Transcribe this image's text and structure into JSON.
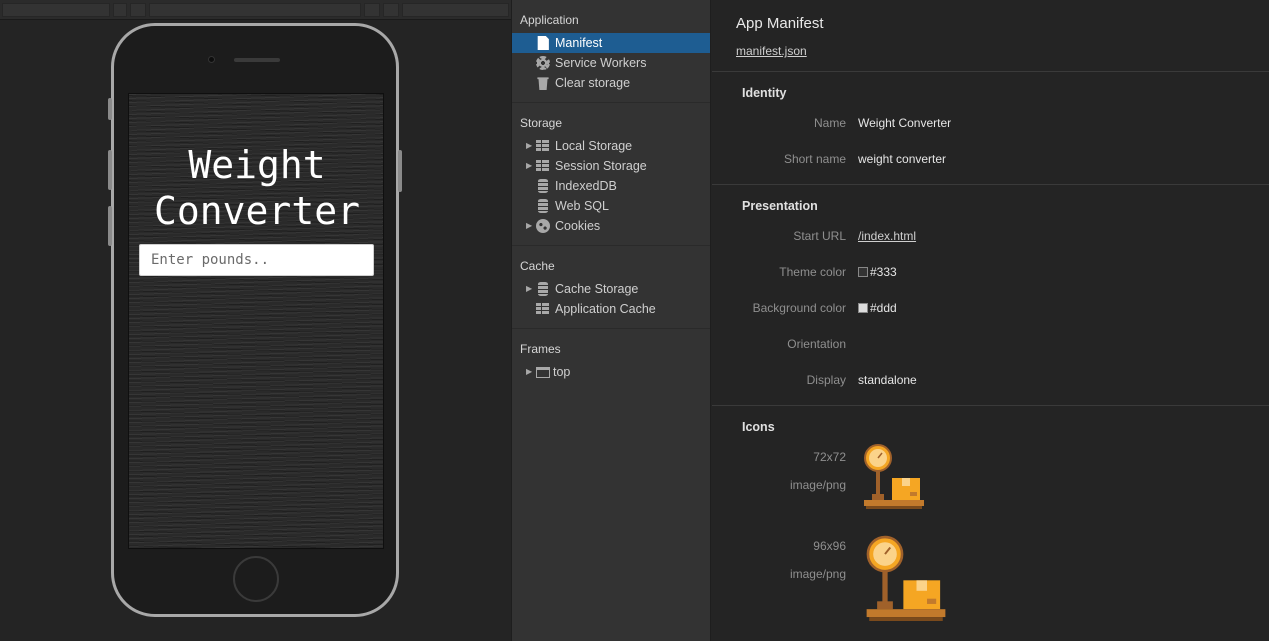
{
  "device": {
    "app_title": "Weight\nConverter",
    "input_placeholder": "Enter pounds.."
  },
  "sidebar": {
    "sections": [
      {
        "title": "Application",
        "items": [
          {
            "label": "Manifest",
            "icon": "document-icon",
            "selected": true
          },
          {
            "label": "Service Workers",
            "icon": "gear-icon"
          },
          {
            "label": "Clear storage",
            "icon": "trash-icon"
          }
        ]
      },
      {
        "title": "Storage",
        "items": [
          {
            "label": "Local Storage",
            "icon": "grid-icon",
            "expandable": true
          },
          {
            "label": "Session Storage",
            "icon": "grid-icon",
            "expandable": true
          },
          {
            "label": "IndexedDB",
            "icon": "database-icon"
          },
          {
            "label": "Web SQL",
            "icon": "database-icon"
          },
          {
            "label": "Cookies",
            "icon": "cookie-icon",
            "expandable": true
          }
        ]
      },
      {
        "title": "Cache",
        "items": [
          {
            "label": "Cache Storage",
            "icon": "database-icon",
            "expandable": true
          },
          {
            "label": "Application Cache",
            "icon": "grid-icon"
          }
        ]
      },
      {
        "title": "Frames",
        "items": [
          {
            "label": "top",
            "icon": "frame-icon",
            "expandable": true
          }
        ]
      }
    ]
  },
  "manifest": {
    "title": "App Manifest",
    "link": "manifest.json",
    "identity": {
      "heading": "Identity",
      "name_label": "Name",
      "name_value": "Weight Converter",
      "short_name_label": "Short name",
      "short_name_value": "weight converter"
    },
    "presentation": {
      "heading": "Presentation",
      "start_url_label": "Start URL",
      "start_url_value": "/index.html",
      "theme_color_label": "Theme color",
      "theme_color_value": "#333",
      "background_color_label": "Background color",
      "background_color_value": "#ddd",
      "orientation_label": "Orientation",
      "display_label": "Display",
      "display_value": "standalone"
    },
    "icons": {
      "heading": "Icons",
      "list": [
        {
          "size": "72x72",
          "type": "image/png"
        },
        {
          "size": "96x96",
          "type": "image/png"
        }
      ]
    }
  },
  "colors": {
    "selected": "#1e5d92",
    "theme_swatch": "#333333",
    "background_swatch": "#dddddd",
    "icon_orange": "#f5a623",
    "icon_brown": "#a0612a"
  }
}
